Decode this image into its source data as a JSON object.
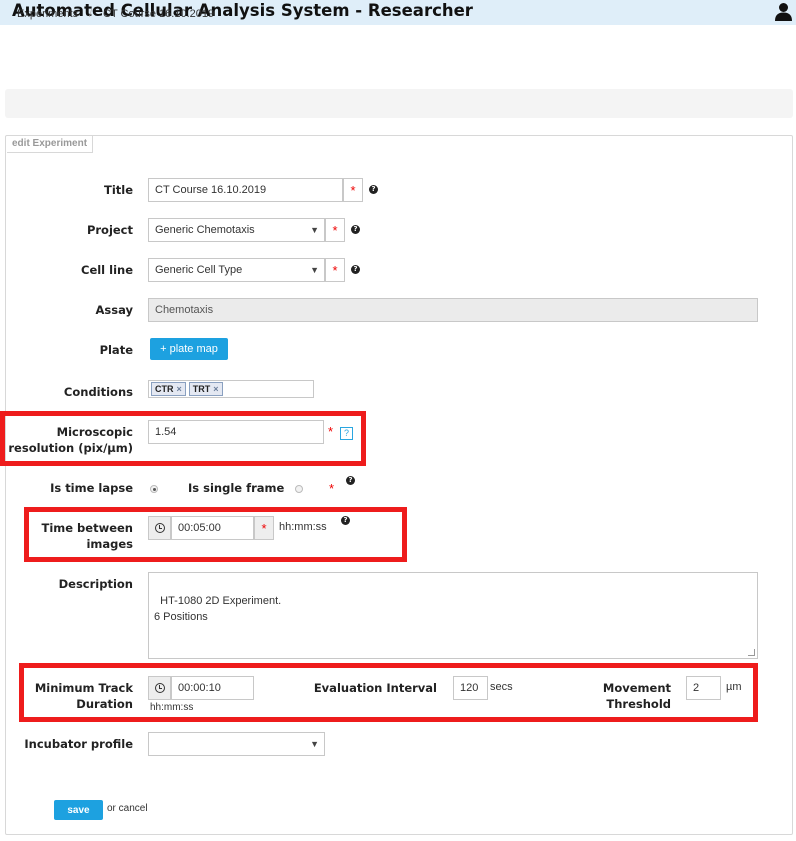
{
  "app": {
    "title": "Automated Cellular Analysis System - Researcher",
    "user_icon": "user-icon"
  },
  "breadcrumb": {
    "items": [
      "Experiments",
      "CT Course 16.10.2019"
    ],
    "separator": "/"
  },
  "form": {
    "legend": "edit Experiment",
    "required_mark": "*",
    "help_mark": "?",
    "title": {
      "label": "Title",
      "value": "CT Course 16.10.2019"
    },
    "project": {
      "label": "Project",
      "value": "Generic Chemotaxis"
    },
    "cell_line": {
      "label": "Cell line",
      "value": "Generic Cell Type"
    },
    "assay": {
      "label": "Assay",
      "value": "Chemotaxis"
    },
    "plate": {
      "label": "Plate",
      "button": "+ plate map"
    },
    "conditions": {
      "label": "Conditions",
      "tags": [
        "CTR",
        "TRT"
      ],
      "remove_mark": "×"
    },
    "resolution": {
      "label_line1": "Microscopic",
      "label_line2": "resolution (pix/µm)",
      "value": "1.54"
    },
    "mode": {
      "time_lapse_label": "Is time lapse",
      "single_frame_label": "Is single frame",
      "selected": "time_lapse"
    },
    "time_between": {
      "label_line1": "Time between",
      "label_line2": "images",
      "value": "00:05:00",
      "unit": "hh:mm:ss"
    },
    "description": {
      "label": "Description",
      "value": "HT-1080 2D Experiment.\n6 Positions"
    },
    "min_track": {
      "label_line1": "Minimum Track",
      "label_line2": "Duration",
      "value": "00:00:10",
      "unit": "hh:mm:ss"
    },
    "evaluation": {
      "label": "Evaluation Interval",
      "value": "120",
      "unit": "secs"
    },
    "movement": {
      "label_line1": "Movement",
      "label_line2": "Threshold",
      "value": "2",
      "unit": "µm"
    },
    "incubator": {
      "label": "Incubator profile",
      "value": ""
    },
    "actions": {
      "save": "save",
      "cancel": "or cancel"
    }
  },
  "colors": {
    "header_bg": "#dfeef9",
    "primary_button": "#1da1e0",
    "highlight_box": "#ee1c1c",
    "required": "#ee0000"
  }
}
